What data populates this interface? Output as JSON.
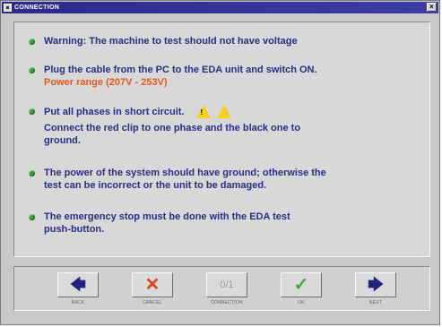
{
  "window": {
    "title": "CONNECTION",
    "close_glyph": "×"
  },
  "instructions": [
    {
      "lines": [
        "Warning: The machine to test should not have voltage"
      ]
    },
    {
      "lines": [
        "Plug the cable from the PC to the EDA unit and switch ON."
      ],
      "highlight": "Power range  (207V - 253V)"
    },
    {
      "lines": [
        "Put all phases in short circuit.",
        "Connect the red clip to one phase and the black one to",
        "ground."
      ]
    },
    {
      "lines": [
        "The power of the system should have ground; otherwise the",
        "test can be incorrect or the unit to be damaged."
      ]
    },
    {
      "lines": [
        "The emergency stop must be done with the EDA test",
        "push-button."
      ]
    }
  ],
  "warning_icons": [
    {
      "name": "warning-icon",
      "glyph": "!"
    },
    {
      "name": "electric-hazard-icon",
      "glyph": "⚡"
    }
  ],
  "toolbar": {
    "buttons": [
      {
        "id": "back",
        "label": "BACK",
        "icon": "arrow-left-icon",
        "glyph": "🡄",
        "enabled": true
      },
      {
        "id": "cancel",
        "label": "CANCEL",
        "icon": "cross-icon",
        "glyph": "✕",
        "enabled": true
      },
      {
        "id": "connection",
        "label": "CONNECTION",
        "icon": "connection-icon",
        "glyph": "0/1",
        "enabled": false
      },
      {
        "id": "ok",
        "label": "OK",
        "icon": "checkmark-icon",
        "glyph": "✓",
        "enabled": true
      },
      {
        "id": "next",
        "label": "NEXT",
        "icon": "arrow-right-icon",
        "glyph": "🡆",
        "enabled": true
      }
    ]
  },
  "colors": {
    "title_bar": "#2a2a8a",
    "text": "#2c2c86",
    "highlight": "#e05a1e",
    "bullet": "#3e9a3e",
    "warning": "#f2d21a"
  }
}
